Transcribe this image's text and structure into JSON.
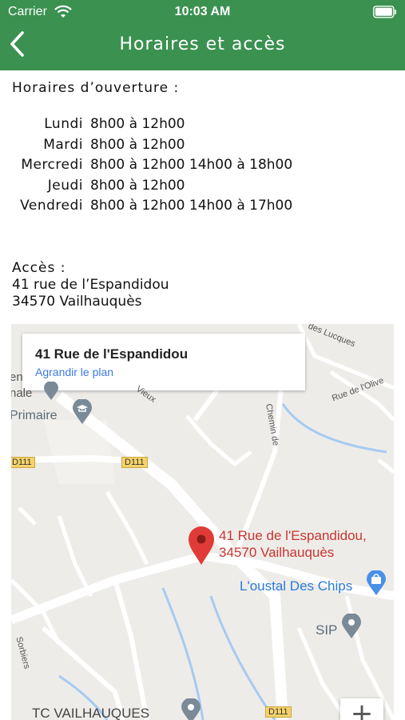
{
  "status_bar": {
    "carrier": "Carrier",
    "time": "10:03 AM"
  },
  "nav": {
    "title": "Horaires et accès"
  },
  "hours": {
    "title": "Horaires d’ouverture :",
    "rows": [
      {
        "day": "Lundi",
        "hours": "8h00 à 12h00"
      },
      {
        "day": "Mardi",
        "hours": "8h00 à 12h00"
      },
      {
        "day": "Mercredi",
        "hours": "8h00 à 12h00 14h00 à 18h00"
      },
      {
        "day": "Jeudi",
        "hours": "8h00 à 12h00"
      },
      {
        "day": "Vendredi",
        "hours": "8h00 à 12h00 14h00 à 17h00"
      }
    ]
  },
  "access": {
    "title": "Accès :",
    "address_line1": "41 rue de l’Espandidou",
    "address_line2": "34570 Vailhauquès"
  },
  "map": {
    "info_title": "41 Rue de l'Espandidou",
    "info_link": "Agrandir le plan",
    "pin_label_line1": "41 Rue de l'Espandidou,",
    "pin_label_line2": "34570 Vailhauquès",
    "poi_primaire": "Primaire",
    "poi_chips": "L'oustal Des Chips",
    "poi_sip": "SIP",
    "poi_tc": "TC VAILHAUQUES",
    "partial_en": "en",
    "partial_nale": "nale",
    "road_d111_a": "D111",
    "road_d111_b": "D111",
    "road_d111_c": "D111",
    "street_lucques": "des Lucques",
    "street_olive": "Rue de l'Olive",
    "street_vieux": "Vieux",
    "street_chemin": "Chemin de",
    "street_sorbiers": "Sorbiers",
    "zoom_in": "+",
    "colors": {
      "water": "#a6cbf2",
      "road": "#ffffff",
      "pin": "#e03b36",
      "pin_text": "#c8352f",
      "poi_blue": "#2a7ad8"
    }
  },
  "colors": {
    "header": "#3a9150"
  }
}
